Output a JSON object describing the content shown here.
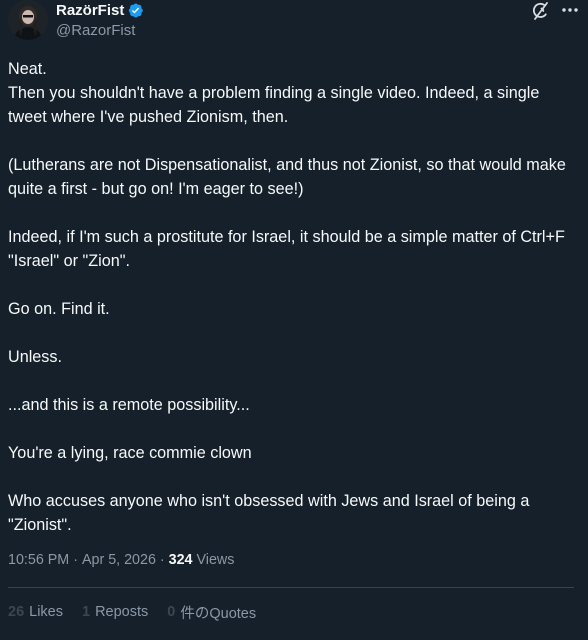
{
  "author": {
    "display_name": "RazörFist",
    "handle": "@RazorFist",
    "verified": true,
    "avatar_icon": "avatar-image"
  },
  "header_icons": {
    "grok": "grok-icon",
    "more": "more-icon"
  },
  "body": {
    "paragraphs": [
      [
        "Neat.",
        "Then you shouldn't have a problem finding a single video. Indeed, a single tweet where I've pushed Zionism, then."
      ],
      [
        "(Lutherans are not Dispensationalist, and thus not Zionist, so that would make quite a first - but go on! I'm eager to see!)"
      ],
      [
        "Indeed, if I'm such a prostitute for Israel, it should be a simple matter of Ctrl+F \"Israel\" or \"Zion\"."
      ],
      [
        "Go on. Find it."
      ],
      [
        "Unless."
      ],
      [
        "...and this is a remote possibility..."
      ],
      [
        "You're a lying, race commie clown"
      ],
      [
        "Who accuses anyone who isn't obsessed with Jews and Israel of being a \"Zionist\"."
      ]
    ]
  },
  "meta": {
    "time": "10:56 PM",
    "separator": "·",
    "date": "Apr 5, 2026",
    "views_count": "324",
    "views_label": "Views"
  },
  "stats": {
    "likes_count": "26",
    "likes_label": "Likes",
    "reposts_count": "1",
    "reposts_label": "Reposts",
    "quotes_count": "0",
    "quotes_label": "件のQuotes"
  },
  "colors": {
    "background": "#15202b",
    "text": "#f7f9f9",
    "secondary": "#8b98a5",
    "verified": "#1d9bf0",
    "divider": "#38444d"
  }
}
